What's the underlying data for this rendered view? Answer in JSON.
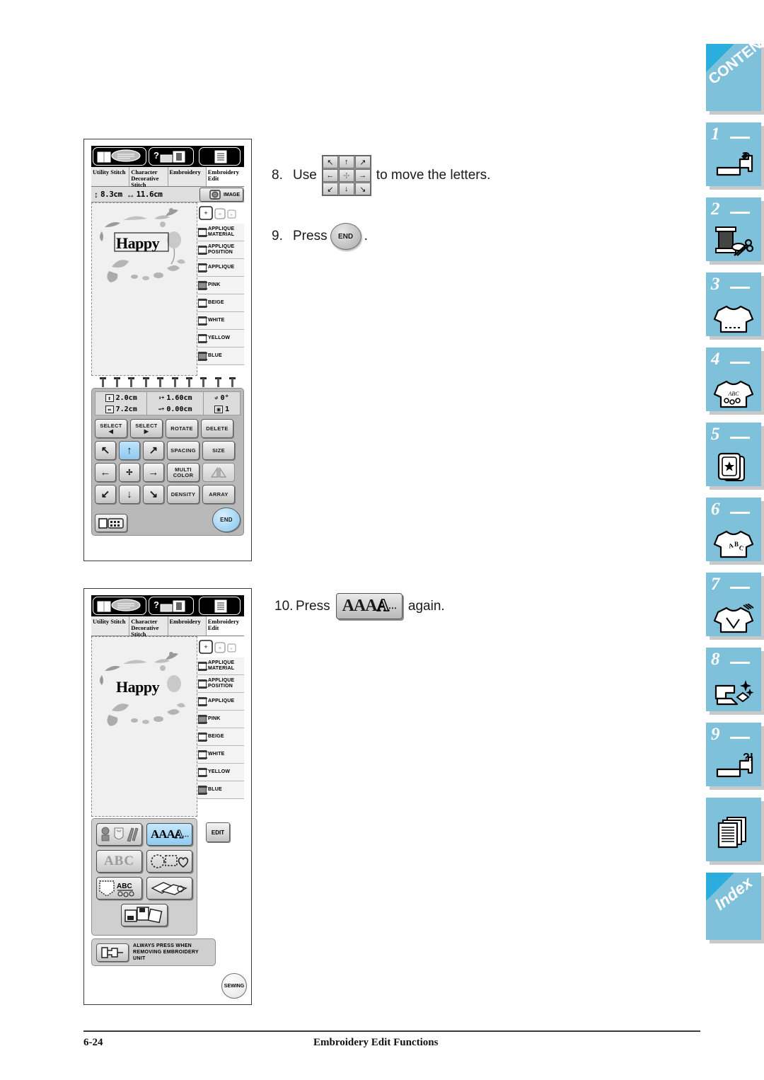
{
  "page": {
    "footer_page_number": "6-24",
    "footer_title": "Embroidery Edit Functions"
  },
  "steps": [
    {
      "number": "8.",
      "text_before": "Use",
      "text_after": "to move the letters.",
      "control": "arrow-dpad"
    },
    {
      "number": "9.",
      "text_before": "Press",
      "text_after": ".",
      "control": "end-button",
      "control_label": "END"
    },
    {
      "number": "10.",
      "text_before": "Press",
      "text_after": "again.",
      "control": "aaa-button",
      "control_label": "AAA"
    }
  ],
  "screen_1": {
    "icon_buttons": [
      "manual-icon",
      "help-icon",
      "settings-icon"
    ],
    "tabs": [
      {
        "label": "Utility Stitch",
        "active": false
      },
      {
        "label": "Character Decorative Stitch",
        "active": false
      },
      {
        "label": "Embroidery",
        "active": false
      },
      {
        "label": "Embroidery Edit",
        "active": true
      }
    ],
    "size_bar": {
      "height": "8.3",
      "height_unit": "cm",
      "width": "11.6",
      "width_unit": "cm",
      "image_button": "IMAGE"
    },
    "design_text": "Happy",
    "color_list": [
      {
        "label": "APPLIQUE MATERIAL",
        "filled": false
      },
      {
        "label": "APPLIQUE POSITION",
        "filled": false
      },
      {
        "label": "APPLIQUE",
        "filled": false
      },
      {
        "label": "PINK",
        "filled": true
      },
      {
        "label": "BEIGE",
        "filled": false
      },
      {
        "label": "WHITE",
        "filled": false
      },
      {
        "label": "YELLOW",
        "filled": false
      },
      {
        "label": "BLUE",
        "filled": true
      }
    ],
    "readout": {
      "vertical_size": "2.0cm",
      "horizontal_size": "7.2cm",
      "vertical_offset": "1.60cm",
      "horizontal_offset": "0.00cm",
      "rotation": "0°",
      "index": "1"
    },
    "buttons": {
      "select_prev": "SELECT",
      "select_next": "SELECT",
      "rotate": "ROTATE",
      "delete": "DELETE",
      "spacing": "SPACING",
      "size": "SIZE",
      "multi_color": "MULTI COLOR",
      "mirror": "MIRROR",
      "density": "DENSITY",
      "array": "ARRAY",
      "end": "END",
      "arrows": {
        "up_left": "↖",
        "up": "↑",
        "up_right": "↗",
        "left": "←",
        "center": "✢",
        "right": "→",
        "down_left": "↙",
        "down": "↓",
        "down_right": "↘"
      },
      "selected_arrow": "up"
    }
  },
  "screen_2": {
    "icon_buttons": [
      "manual-icon",
      "help-icon",
      "settings-icon"
    ],
    "tabs": [
      {
        "label": "Utility Stitch",
        "active": false
      },
      {
        "label": "Character Decorative Stitch",
        "active": false
      },
      {
        "label": "Embroidery",
        "active": false
      },
      {
        "label": "Embroidery Edit",
        "active": true
      }
    ],
    "design_text": "Happy",
    "color_list": [
      {
        "label": "APPLIQUE MATERIAL",
        "filled": false
      },
      {
        "label": "APPLIQUE POSITION",
        "filled": false
      },
      {
        "label": "APPLIQUE",
        "filled": false
      },
      {
        "label": "PINK",
        "filled": true
      },
      {
        "label": "BEIGE",
        "filled": false
      },
      {
        "label": "WHITE",
        "filled": false
      },
      {
        "label": "YELLOW",
        "filled": false
      },
      {
        "label": "BLUE",
        "filled": true
      }
    ],
    "function_buttons": [
      {
        "name": "embroidery-patterns",
        "label": ""
      },
      {
        "name": "lettering-aaa",
        "label": "AAA",
        "selected": true
      },
      {
        "name": "monogram-abc",
        "label": "ABC"
      },
      {
        "name": "frame-shapes",
        "label": ""
      },
      {
        "name": "pocket-abc",
        "label": "ABC"
      },
      {
        "name": "saved-designs",
        "label": ""
      },
      {
        "name": "memory-card",
        "label": ""
      }
    ],
    "edit_button": "EDIT",
    "note_text": "ALWAYS PRESS WHEN REMOVING EMBROIDERY UNIT",
    "sewing_button": "SEWING"
  },
  "side_tabs": [
    {
      "name": "contents",
      "label": "CONTENTS",
      "number": "",
      "icon": ""
    },
    {
      "name": "chapter-1",
      "label": "",
      "number": "1",
      "icon": "sewing-machine-icon"
    },
    {
      "name": "chapter-2",
      "label": "",
      "number": "2",
      "icon": "spool-scissors-icon"
    },
    {
      "name": "chapter-3",
      "label": "",
      "number": "3",
      "icon": "tshirt-icon"
    },
    {
      "name": "chapter-4",
      "label": "",
      "number": "4",
      "icon": "tshirt-abc-icon"
    },
    {
      "name": "chapter-5",
      "label": "",
      "number": "5",
      "icon": "hoop-star-icon"
    },
    {
      "name": "chapter-6",
      "label": "",
      "number": "6",
      "icon": "tshirt-letters-icon"
    },
    {
      "name": "chapter-7",
      "label": "",
      "number": "7",
      "icon": "tshirt-tools-icon"
    },
    {
      "name": "chapter-8",
      "label": "",
      "number": "8",
      "icon": "cleaning-icon"
    },
    {
      "name": "chapter-9",
      "label": "",
      "number": "9",
      "icon": "troubleshoot-icon"
    },
    {
      "name": "appendix",
      "label": "",
      "number": "",
      "icon": "pages-icon"
    },
    {
      "name": "index",
      "label": "Index",
      "number": "",
      "icon": ""
    }
  ],
  "colors": {
    "tab_blue": "#7fc0da",
    "corner_blue": "#2badde",
    "selected_button": "#8ec9ef",
    "shadow_gray": "#c9c9c9"
  }
}
